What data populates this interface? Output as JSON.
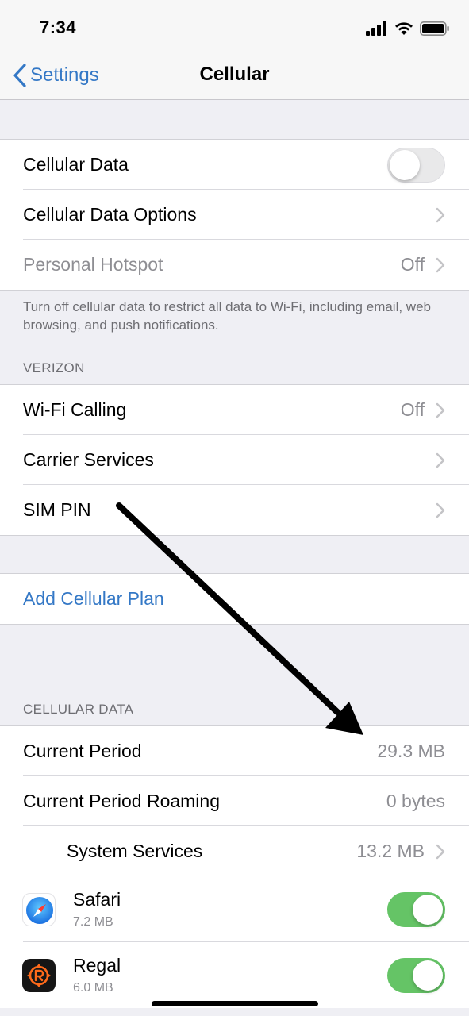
{
  "status_bar": {
    "time": "7:34"
  },
  "nav": {
    "back_label": "Settings",
    "title": "Cellular"
  },
  "group1": {
    "cellular_data": {
      "label": "Cellular Data",
      "toggle_on": false
    },
    "cellular_data_options": {
      "label": "Cellular Data Options"
    },
    "personal_hotspot": {
      "label": "Personal Hotspot",
      "value": "Off"
    },
    "footer": "Turn off cellular data to restrict all data to Wi-Fi, including email, web browsing, and push notifications."
  },
  "carrier_section": {
    "header": "VERIZON",
    "items": [
      {
        "label": "Wi-Fi Calling",
        "value": "Off"
      },
      {
        "label": "Carrier Services",
        "value": ""
      },
      {
        "label": "SIM PIN",
        "value": ""
      }
    ]
  },
  "add_plan": {
    "label": "Add Cellular Plan"
  },
  "usage_section": {
    "header": "CELLULAR DATA",
    "current_period": {
      "label": "Current Period",
      "value": "29.3 MB"
    },
    "current_period_roaming": {
      "label": "Current Period Roaming",
      "value": "0 bytes"
    },
    "system_services": {
      "label": "System Services",
      "value": "13.2 MB"
    },
    "apps": [
      {
        "name": "Safari",
        "usage": "7.2 MB",
        "toggle_on": true,
        "icon": "safari-icon"
      },
      {
        "name": "Regal",
        "usage": "6.0 MB",
        "toggle_on": true,
        "icon": "regal-app-icon"
      }
    ]
  },
  "colors": {
    "accent": "#3478c6",
    "toggle_on": "#65c466",
    "background": "#efeff4"
  }
}
